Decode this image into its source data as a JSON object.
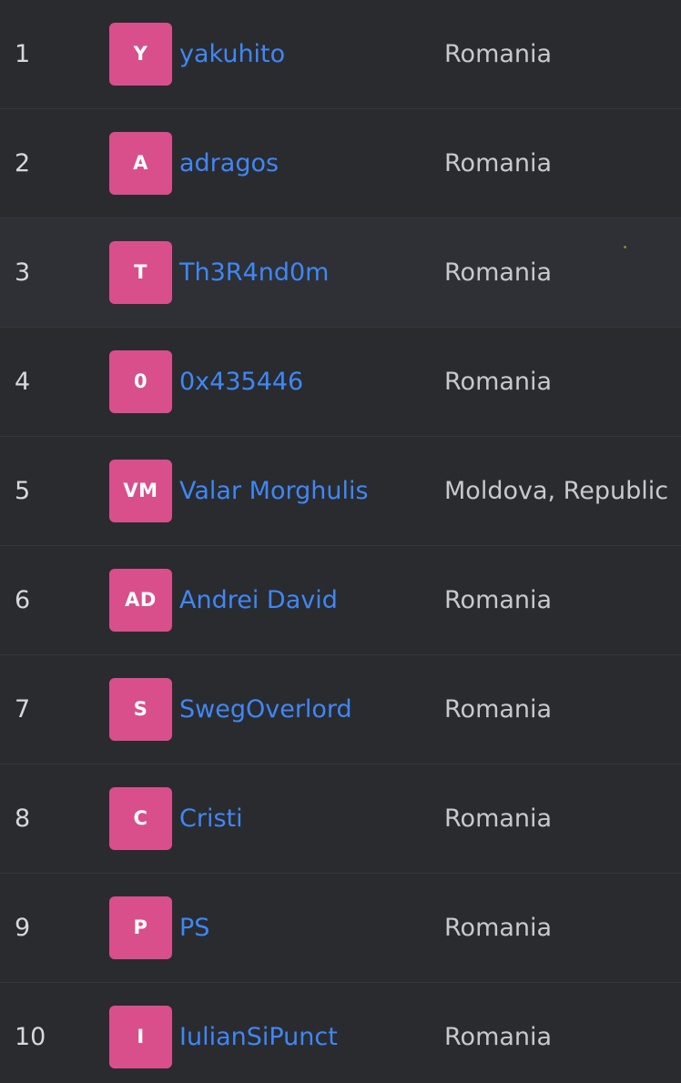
{
  "leaderboard": {
    "rows": [
      {
        "rank": "1",
        "initials": "Y",
        "username": "yakuhito",
        "country": "Romania"
      },
      {
        "rank": "2",
        "initials": "A",
        "username": "adragos",
        "country": "Romania"
      },
      {
        "rank": "3",
        "initials": "T",
        "username": "Th3R4nd0m",
        "country": "Romania"
      },
      {
        "rank": "4",
        "initials": "0",
        "username": "0x435446",
        "country": "Romania"
      },
      {
        "rank": "5",
        "initials": "VM",
        "username": "Valar Morghulis",
        "country": "Moldova, Republic"
      },
      {
        "rank": "6",
        "initials": "AD",
        "username": "Andrei David",
        "country": "Romania"
      },
      {
        "rank": "7",
        "initials": "S",
        "username": "SwegOverlord",
        "country": "Romania"
      },
      {
        "rank": "8",
        "initials": "C",
        "username": "Cristi",
        "country": "Romania"
      },
      {
        "rank": "9",
        "initials": "P",
        "username": "PS",
        "country": "Romania"
      },
      {
        "rank": "10",
        "initials": "I",
        "username": "IulianSiPunct",
        "country": "Romania"
      }
    ]
  },
  "colors": {
    "background": "#2a2b2f",
    "highlight_row": "#2e3035",
    "avatar": "#d94f8b",
    "link": "#3f87f5",
    "text": "#c8c9cc"
  }
}
